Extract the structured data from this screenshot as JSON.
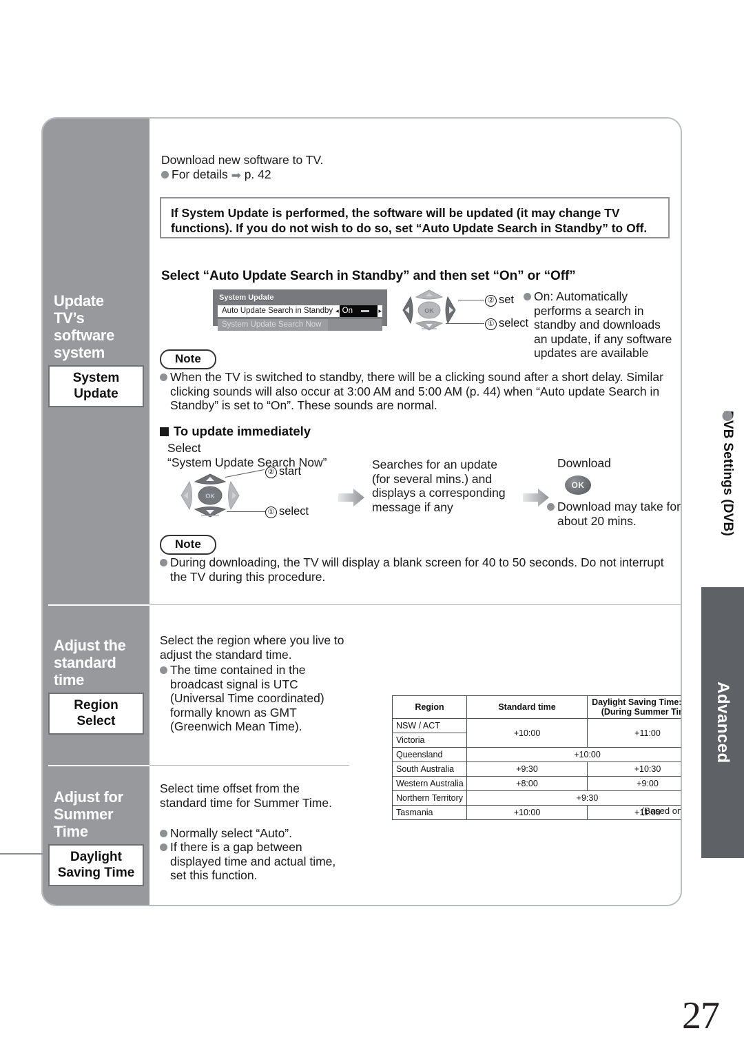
{
  "page": {
    "number": "27",
    "side_tab": "Advanced",
    "vertical_label": "DVB Settings (DVB)"
  },
  "sidebar": {
    "blocks": [
      {
        "heading": "Update\nTV’s\nsoftware\nsystem",
        "chip": "System\nUpdate"
      },
      {
        "heading": "Adjust the\nstandard time",
        "chip": "Region\nSelect"
      },
      {
        "heading": "Adjust for\nSummer Time",
        "chip": "Daylight\nSaving Time"
      }
    ]
  },
  "system_update": {
    "intro_line": "Download new software to TV.",
    "intro_bullet_prefix": "For details",
    "intro_bullet_arrow": "➡",
    "intro_bullet_page": "p. 42",
    "warning": "If System Update is performed, the software will be updated (it may change TV functions). If you do not wish to do so, set “Auto Update Search in Standby” to Off.",
    "step_heading": "Select “Auto Update Search in Standby” and then set “On” or “Off”",
    "osd": {
      "title": "System Update",
      "row1_label": "Auto Update Search in Standby",
      "row1_value": "On",
      "row2_label": "System Update Search Now"
    },
    "dpad1": {
      "ok_label": "OK",
      "cue_set_num": "②",
      "cue_set_label": "set",
      "cue_select_num": "①",
      "cue_select_label": "select"
    },
    "on_description": "On: Automatically performs a search in standby and downloads an update, if any software updates are available",
    "note1_title": "Note",
    "note1_text": "When the TV is switched to standby, there will be a clicking sound after a short delay. Similar clicking sounds will also occur at 3:00 AM and 5:00 AM (p. 44) when “Auto update Search in Standby” is set to “On”. These sounds are normal.",
    "immediate_heading": "To update immediately",
    "immediate": {
      "select_line1": "Select",
      "select_line2": "“System Update Search Now”",
      "cue_start_num": "②",
      "cue_start_label": "start",
      "cue_select_num": "①",
      "cue_select_label": "select",
      "ok_label": "OK",
      "middle_text": "Searches for an update (for several mins.) and displays a corresponding message if any",
      "download_title": "Download",
      "download_note": "Download may take for about 20 mins."
    },
    "note2_title": "Note",
    "note2_text": "During downloading, the TV will display a blank screen for 40 to 50 seconds. Do not interrupt the TV during this procedure."
  },
  "region_select": {
    "intro": "Select the region where you live to adjust the standard time.",
    "bullet": "The time contained in the broadcast signal is UTC (Universal Time coordinated) formally known as GMT (Greenwich Mean Time).",
    "table": {
      "headers": [
        "Region",
        "Standard time",
        "Daylight Saving Time: Auto\n(During Summer Time)"
      ],
      "header_dst_line1": "Daylight Saving Time: Auto",
      "header_dst_line2": "(During Summer Time)",
      "rows": [
        {
          "region": "NSW / ACT",
          "standard": "+10:00",
          "dst": "+11:00"
        },
        {
          "region": "Victoria",
          "standard": "+10:00",
          "dst": "+11:00"
        },
        {
          "region": "Queensland",
          "standard": "+10:00",
          "dst": "+10:00",
          "span": true
        },
        {
          "region": "South Australia",
          "standard": "+9:30",
          "dst": "+10:30"
        },
        {
          "region": "Western Australia",
          "standard": "+8:00",
          "dst": "+9:00"
        },
        {
          "region": "Northern Territory",
          "standard": "+9:30",
          "dst": "+9:30",
          "span": true
        },
        {
          "region": "Tasmania",
          "standard": "+10:00",
          "dst": "+11:00"
        }
      ],
      "footnote": "(Based on GMT)"
    }
  },
  "daylight_saving": {
    "intro": "Select time offset from the standard time for Summer Time.",
    "bullet1": "Normally select “Auto”.",
    "bullet2": "If there is a gap between displayed time and actual time, set this function."
  }
}
